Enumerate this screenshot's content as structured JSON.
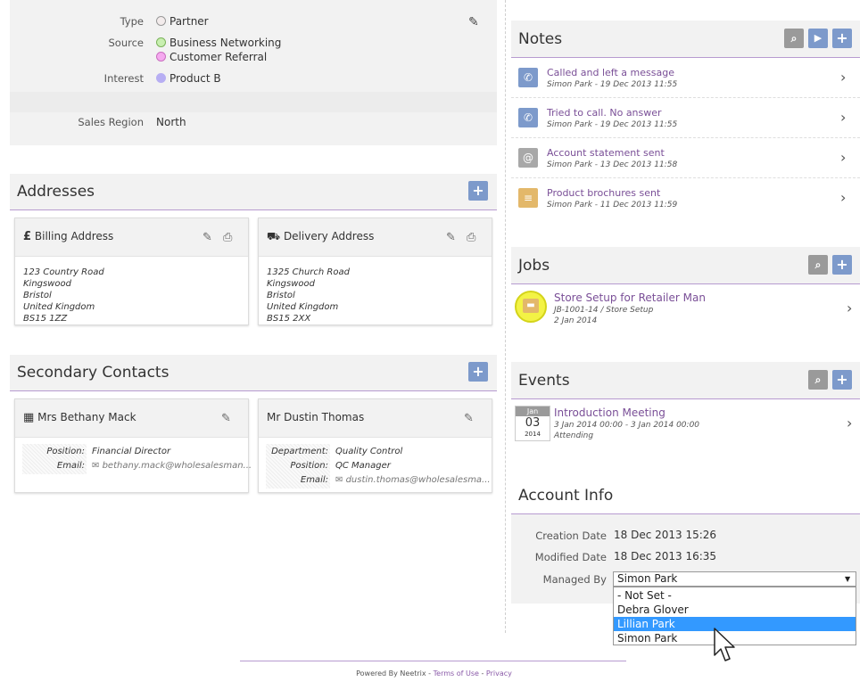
{
  "properties": {
    "type_label": "Type",
    "type_value": "Partner",
    "source_label": "Source",
    "source_values": [
      "Business Networking",
      "Customer Referral"
    ],
    "interest_label": "Interest",
    "interest_value": "Product B",
    "region_label": "Sales Region",
    "region_value": "North"
  },
  "addresses": {
    "title": "Addresses",
    "billing": {
      "title": "Billing Address",
      "lines": [
        "123 Country Road",
        "Kingswood",
        "Bristol",
        "United Kingdom",
        "BS15 1ZZ"
      ]
    },
    "delivery": {
      "title": "Delivery Address",
      "lines": [
        "1325 Church Road",
        "Kingswood",
        "Bristol",
        "United Kingdom",
        "BS15 2XX"
      ]
    }
  },
  "contacts": {
    "title": "Secondary Contacts",
    "c1": {
      "name": "Mrs Bethany Mack",
      "position_label": "Position:",
      "position": "Financial Director",
      "email_label": "Email:",
      "email": "bethany.mack@wholesalesman..."
    },
    "c2": {
      "name": "Mr Dustin Thomas",
      "department_label": "Department:",
      "department": "Quality Control",
      "position_label": "Position:",
      "position": "QC Manager",
      "email_label": "Email:",
      "email": "dustin.thomas@wholesalesma..."
    }
  },
  "notes": {
    "title": "Notes",
    "items": [
      {
        "title": "Called and left a message",
        "sub": "Simon Park - 19 Dec 2013 11:55",
        "icon": "phone-icon",
        "color": "#7d9acb"
      },
      {
        "title": "Tried to call. No answer",
        "sub": "Simon Park - 19 Dec 2013 11:55",
        "icon": "phone-icon",
        "color": "#7d9acb"
      },
      {
        "title": "Account statement sent",
        "sub": "Simon Park - 13 Dec 2013 11:58",
        "icon": "at-icon",
        "color": "#a8a8a8"
      },
      {
        "title": "Product brochures sent",
        "sub": "Simon Park - 11 Dec 2013 11:59",
        "icon": "list-icon",
        "color": "#e3b86a"
      }
    ]
  },
  "jobs": {
    "title": "Jobs",
    "item": {
      "title": "Store Setup for Retailer Man",
      "ref": "JB-1001-14 / Store Setup",
      "date": "2 Jan 2014"
    }
  },
  "events": {
    "title": "Events",
    "item": {
      "month": "Jan",
      "day": "03",
      "year": "2014",
      "title": "Introduction Meeting",
      "range": "3 Jan 2014 00:00 - 3 Jan 2014 00:00",
      "status": "Attending"
    }
  },
  "account_info": {
    "title": "Account Info",
    "creation_label": "Creation Date",
    "creation_value": "18 Dec 2013 15:26",
    "modified_label": "Modified Date",
    "modified_value": "18 Dec 2013 16:35",
    "managed_label": "Managed By",
    "managed_value": "Simon Park",
    "options": [
      "- Not Set -",
      "Debra Glover",
      "Lillian Park",
      "Simon Park"
    ]
  },
  "footer": {
    "powered": "Powered By Neetrix",
    "sep": " - ",
    "terms": "Terms of Use",
    "privacy": "Privacy"
  },
  "colors": {
    "accent": "#7d9acb",
    "link": "#7a4f97",
    "select_highlight": "#3399ff"
  }
}
